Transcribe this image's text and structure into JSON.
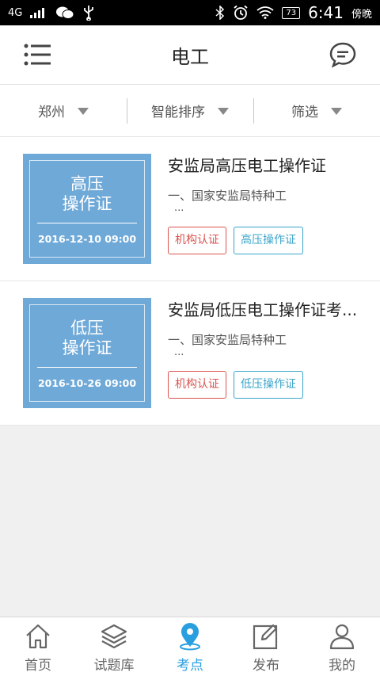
{
  "status_bar": {
    "network": "4G",
    "battery": "73",
    "time": "6:41",
    "period": "傍晚"
  },
  "app_bar": {
    "title": "电工",
    "menu_icon": "list-menu-icon",
    "chat_icon": "chat-bubble-icon"
  },
  "filters": [
    {
      "label": "郑州"
    },
    {
      "label": "智能排序"
    },
    {
      "label": "筛选"
    }
  ],
  "items": [
    {
      "thumb_title_line1": "高压",
      "thumb_title_line2": "操作证",
      "thumb_date": "2016-12-10 09:00",
      "title": "安监局高压电工操作证",
      "desc": "一、国家安监局特种工",
      "ellipsis": "...",
      "tag1": "机构认证",
      "tag2": "高压操作证"
    },
    {
      "thumb_title_line1": "低压",
      "thumb_title_line2": "操作证",
      "thumb_date": "2016-10-26 09:00",
      "title": "安监局低压电工操作证考...",
      "desc": "一、国家安监局特种工",
      "ellipsis": "...",
      "tag1": "机构认证",
      "tag2": "低压操作证"
    }
  ],
  "tabs": [
    {
      "label": "首页",
      "icon": "home-icon"
    },
    {
      "label": "试题库",
      "icon": "layers-icon"
    },
    {
      "label": "考点",
      "icon": "location-pin-icon"
    },
    {
      "label": "发布",
      "icon": "edit-icon"
    },
    {
      "label": "我的",
      "icon": "user-icon"
    }
  ],
  "colors": {
    "accent": "#2a9fe0",
    "thumb_bg": "#6fa9d8",
    "tag_red": "#d9534f",
    "tag_blue": "#3aa4c9"
  }
}
